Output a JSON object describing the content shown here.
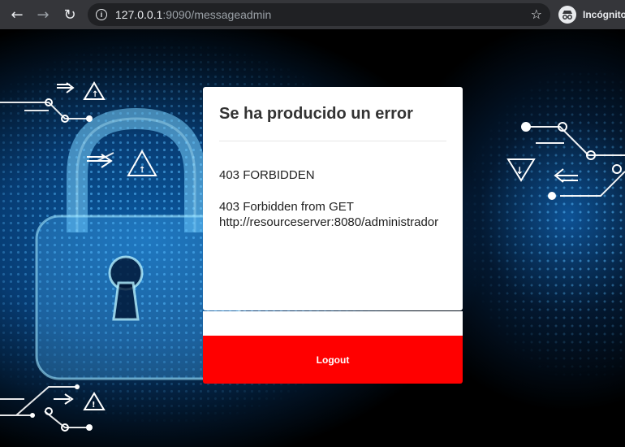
{
  "browser": {
    "back_icon": "arrow-left-icon",
    "forward_icon": "arrow-right-icon",
    "reload_icon": "reload-icon",
    "url_host": "127.0.0.1",
    "url_rest": ":9090/messageadmin",
    "incognito_label": "Incógnito"
  },
  "card": {
    "title": "Se ha producido un error",
    "error_code": "403 FORBIDDEN",
    "error_message": "403 Forbidden from GET http://resourceserver:8080/administrador"
  },
  "logout_label": "Logout",
  "colors": {
    "logout_bg": "#ff0000",
    "chrome_bg": "#35363a",
    "omnibox_bg": "#202124"
  }
}
